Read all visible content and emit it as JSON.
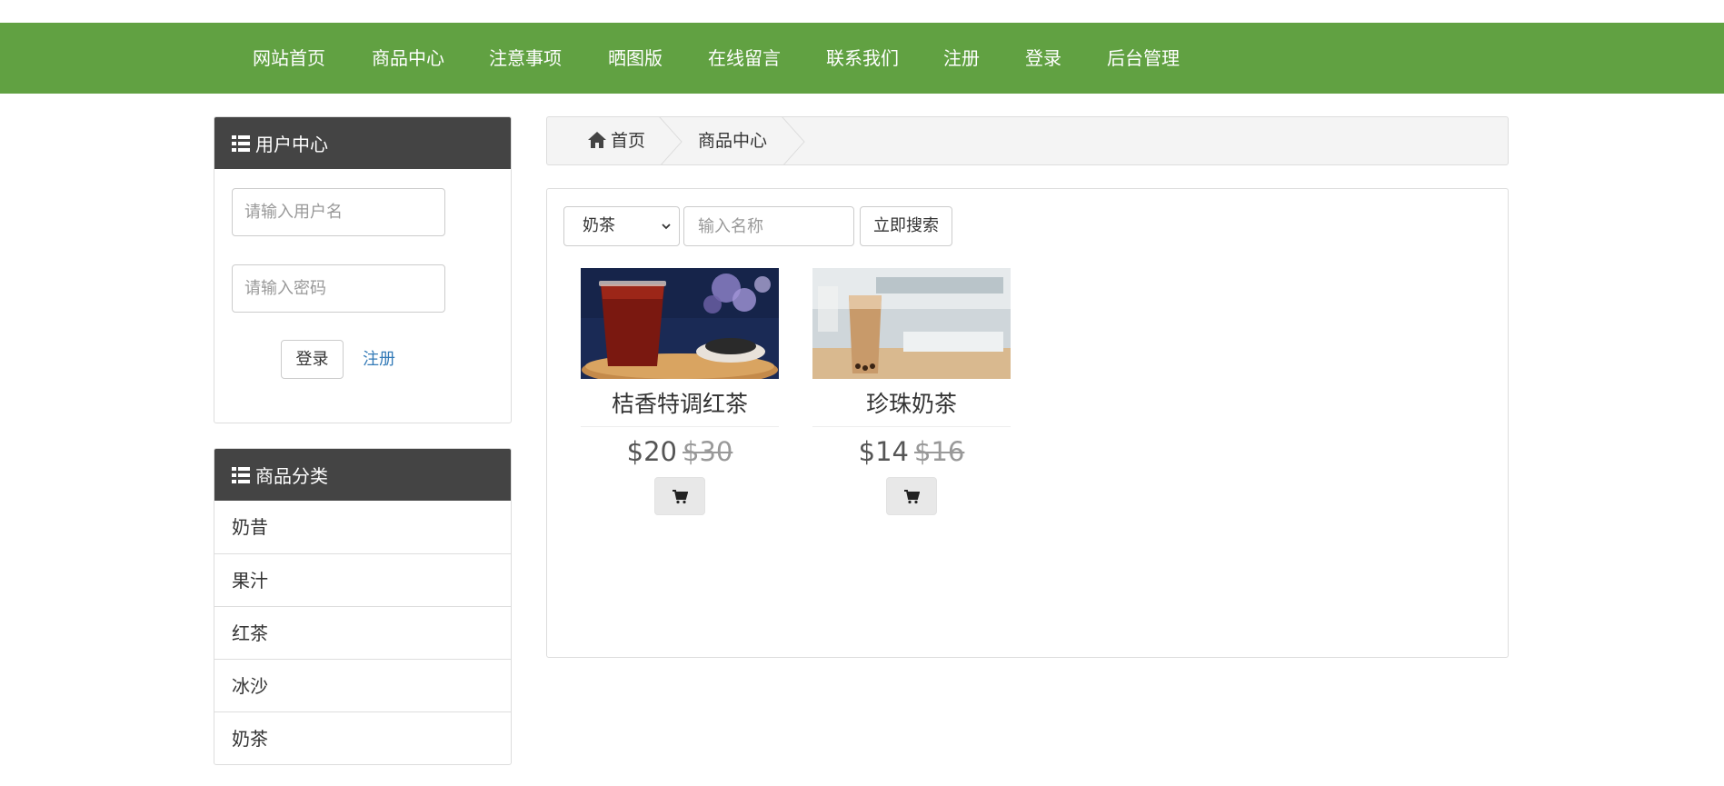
{
  "nav": {
    "items": [
      {
        "label": "网站首页"
      },
      {
        "label": "商品中心"
      },
      {
        "label": "注意事项"
      },
      {
        "label": "晒图版"
      },
      {
        "label": "在线留言"
      },
      {
        "label": "联系我们"
      },
      {
        "label": "注册"
      },
      {
        "label": "登录"
      },
      {
        "label": "后台管理"
      }
    ]
  },
  "user_center": {
    "title": "用户中心",
    "username_placeholder": "请输入用户名",
    "password_placeholder": "请输入密码",
    "login_label": "登录",
    "register_label": "注册"
  },
  "categories": {
    "title": "商品分类",
    "items": [
      "奶昔",
      "果汁",
      "红茶",
      "冰沙",
      "奶茶"
    ]
  },
  "breadcrumb": {
    "home_icon": "home-icon",
    "home": "首页",
    "current": "商品中心"
  },
  "search": {
    "selected_category": "奶茶",
    "placeholder": "输入名称",
    "button_label": "立即搜索"
  },
  "products": [
    {
      "name": "桔香特调红茶",
      "price": "$20",
      "old_price": "$30",
      "cart_icon": "cart-icon"
    },
    {
      "name": "珍珠奶茶",
      "price": "$14",
      "old_price": "$16",
      "cart_icon": "cart-icon"
    }
  ],
  "colors": {
    "nav_bg": "#61a142",
    "panel_head_bg": "#444444",
    "link": "#337ab7"
  }
}
